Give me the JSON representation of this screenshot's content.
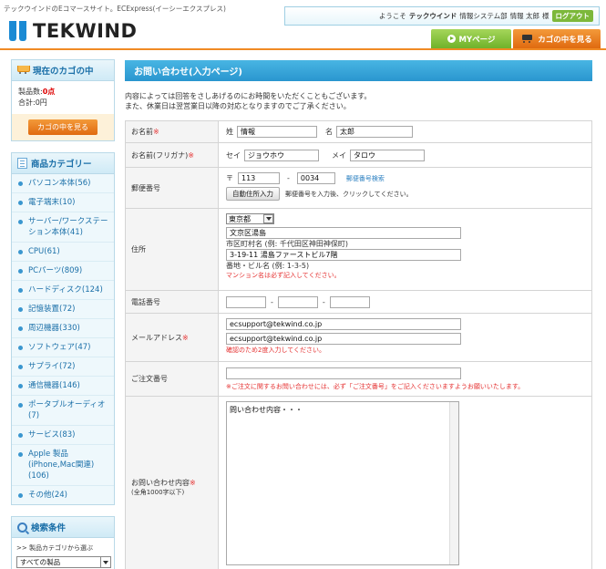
{
  "header": {
    "tagline": "テックウインドのEコマースサイト。ECExpress(イーシーエクスプレス)",
    "logo_text": "TEKWIND",
    "welcome_prefix": "ようこそ",
    "welcome_company": "テックウインド",
    "welcome_dept": "情報システム部",
    "welcome_name": "情報 太郎",
    "welcome_suffix": "様",
    "logout_label": "ログアウト",
    "mypage_label": "MYページ",
    "cart_label": "カゴの中を見る"
  },
  "sidebar": {
    "cart": {
      "title": "現在のカゴの中",
      "count_label": "製品数:",
      "count_value": "0点",
      "total_label": "合計:",
      "total_value": "0円",
      "button_label": "カゴの中を見る"
    },
    "categories": {
      "title": "商品カテゴリー",
      "items": [
        "パソコン本体(56)",
        "電子端末(10)",
        "サーバー/ワークステーション本体(41)",
        "CPU(61)",
        "PCパーツ(809)",
        "ハードディスク(124)",
        "記憶装置(72)",
        "周辺機器(330)",
        "ソフトウェア(47)",
        "サプライ(72)",
        "通信機器(146)",
        "ポータブルオーディオ(7)",
        "サービス(83)",
        "Apple 製品(iPhone,Mac関連)(106)",
        "その他(24)"
      ]
    },
    "search": {
      "title": "検索条件",
      "label": ">> 製品カテゴリから選ぶ",
      "select_value": "すべての製品"
    }
  },
  "main": {
    "title": "お問い合わせ(入力ページ)",
    "intro_line1": "内容によっては回答をさしあげるのにお時間をいただくこともございます。",
    "intro_line2": "また、休業日は翌営業日以降の対応となりますのでご了承ください。",
    "form": {
      "name": {
        "label": "お名前",
        "req": "※",
        "sei_label": "姓",
        "sei_value": "情報",
        "mei_label": "名",
        "mei_value": "太郎"
      },
      "kana": {
        "label": "お名前(フリガナ)",
        "req": "※",
        "sei_label": "セイ",
        "sei_value": "ジョウホウ",
        "mei_label": "メイ",
        "mei_value": "タロウ"
      },
      "postal": {
        "label": "郵便番号",
        "mark": "〒",
        "zip1": "113",
        "dash": "-",
        "zip2": "0034",
        "lookup_link": "郵便番号検索",
        "auto_button": "自動住所入力",
        "auto_help": "郵便番号を入力後、クリックしてください。"
      },
      "address": {
        "label": "住所",
        "pref_value": "東京都",
        "city_value": "文京区湯島",
        "city_help": "市区町村名 (例: 千代田区神田神保町)",
        "street_value": "3-19-11 湯島ファーストビル7階",
        "street_help": "番地・ビル名 (例: 1-3-5)",
        "note": "マンション名は必ず記入してください。"
      },
      "phone": {
        "label": "電話番号",
        "dash1": "-",
        "dash2": "-"
      },
      "email": {
        "label": "メールアドレス",
        "req": "※",
        "value1": "ecsupport@tekwind.co.jp",
        "value2": "ecsupport@tekwind.co.jp",
        "note": "確認のため2度入力してください。"
      },
      "order": {
        "label": "ご注文番号",
        "note": "※ご注文に関するお問い合わせには、必ず「ご注文番号」をご記入くださいますようお願いいたします。"
      },
      "inquiry": {
        "label": "お問い合わせ内容",
        "req": "※",
        "sub": "(全角1000字以下)",
        "value": "問い合わせ内容・・・"
      }
    }
  }
}
